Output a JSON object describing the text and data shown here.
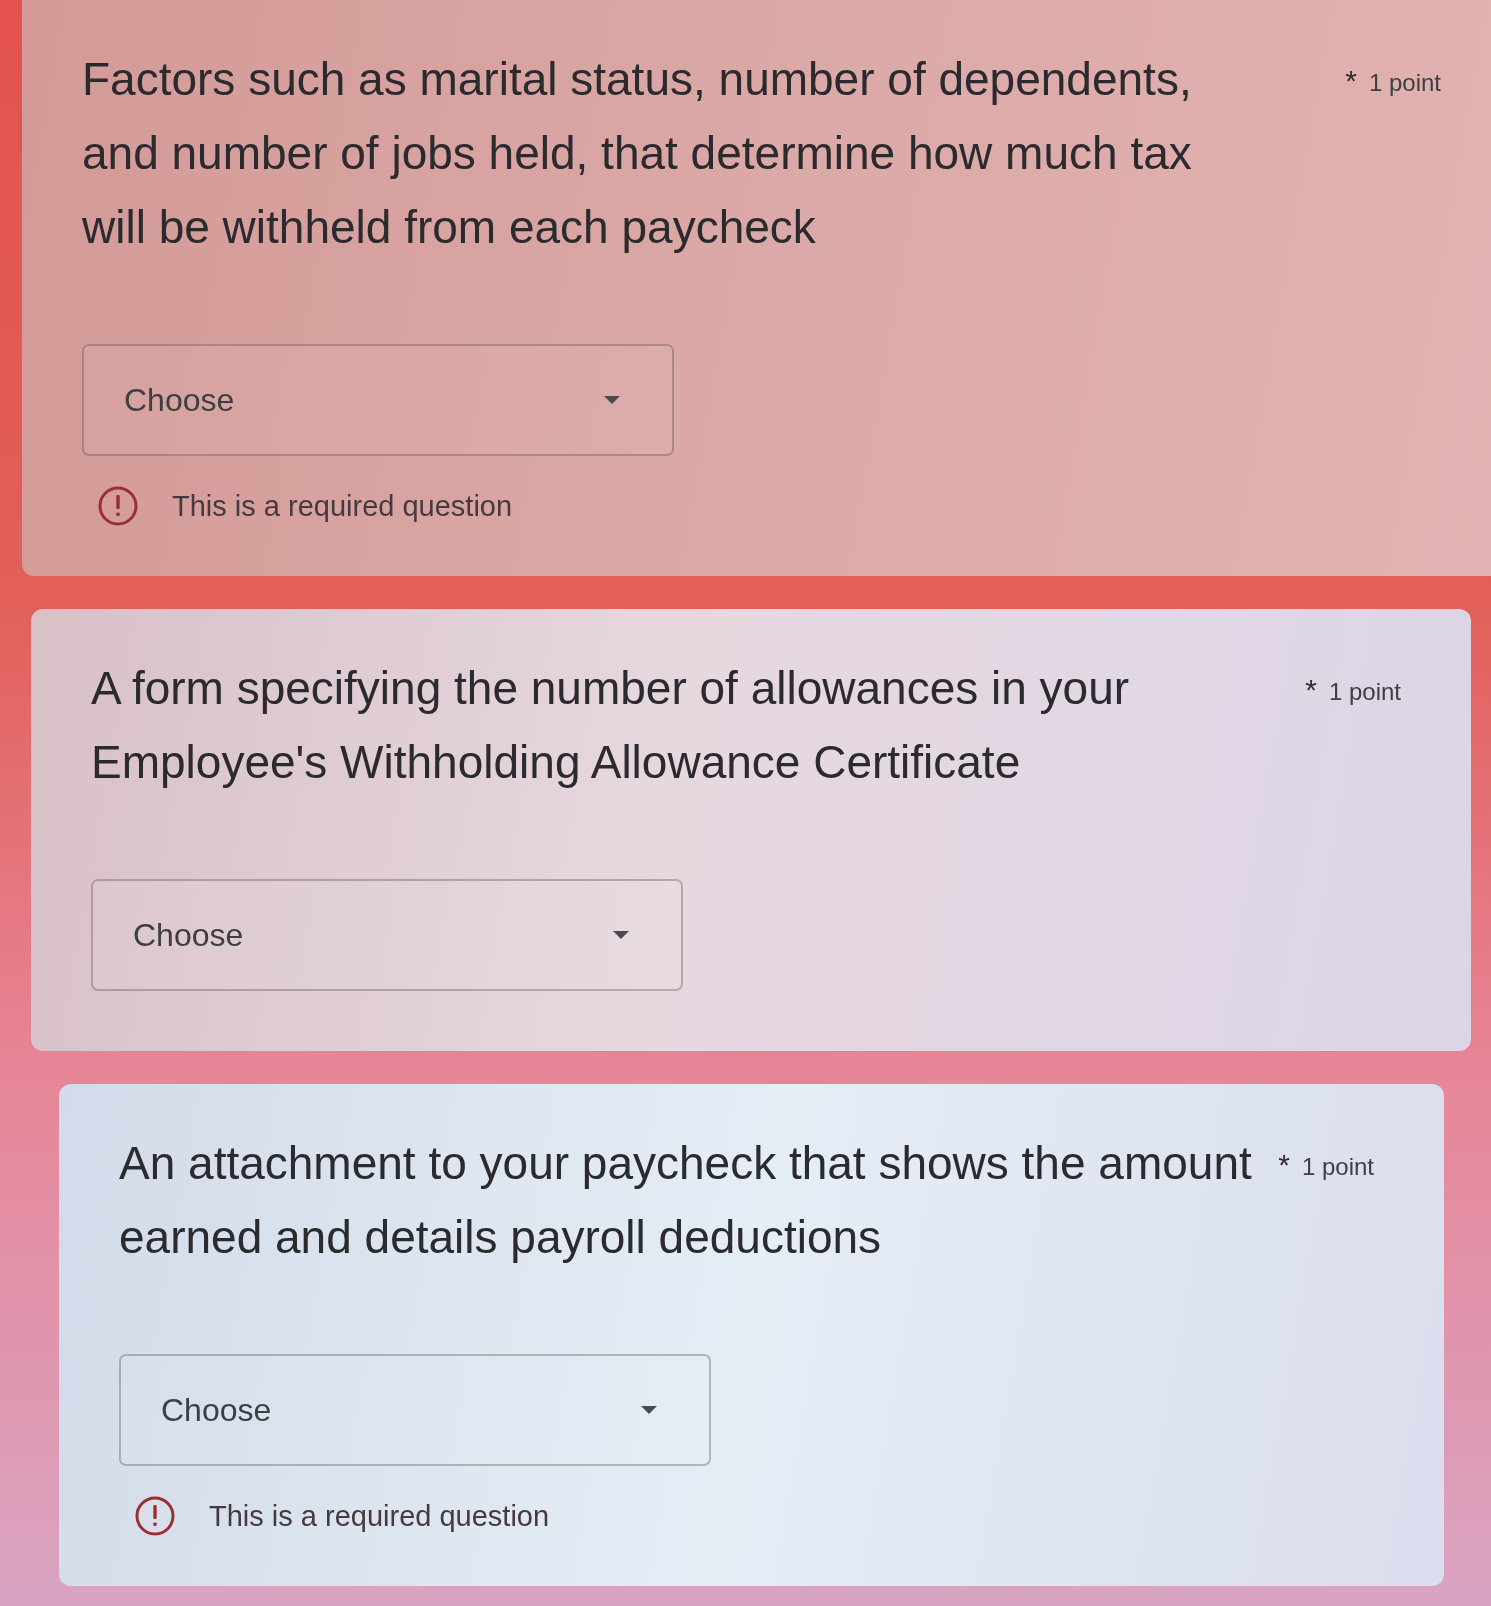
{
  "questions": [
    {
      "title": "Factors such as marital status, number of dependents, and number of jobs held, that determine how much tax will be withheld from each paycheck",
      "required_mark": "*",
      "points": "1 point",
      "dropdown": {
        "label": "Choose"
      },
      "error": "This is a required question"
    },
    {
      "title": "A form specifying the number of allowances in your Employee's Withholding Allowance Certificate",
      "required_mark": "*",
      "points": "1 point",
      "dropdown": {
        "label": "Choose"
      }
    },
    {
      "title": "An attachment to your paycheck that shows the amount earned and details payroll deductions",
      "required_mark": "*",
      "points": "1 point",
      "dropdown": {
        "label": "Choose"
      },
      "error": "This is a required question"
    }
  ]
}
